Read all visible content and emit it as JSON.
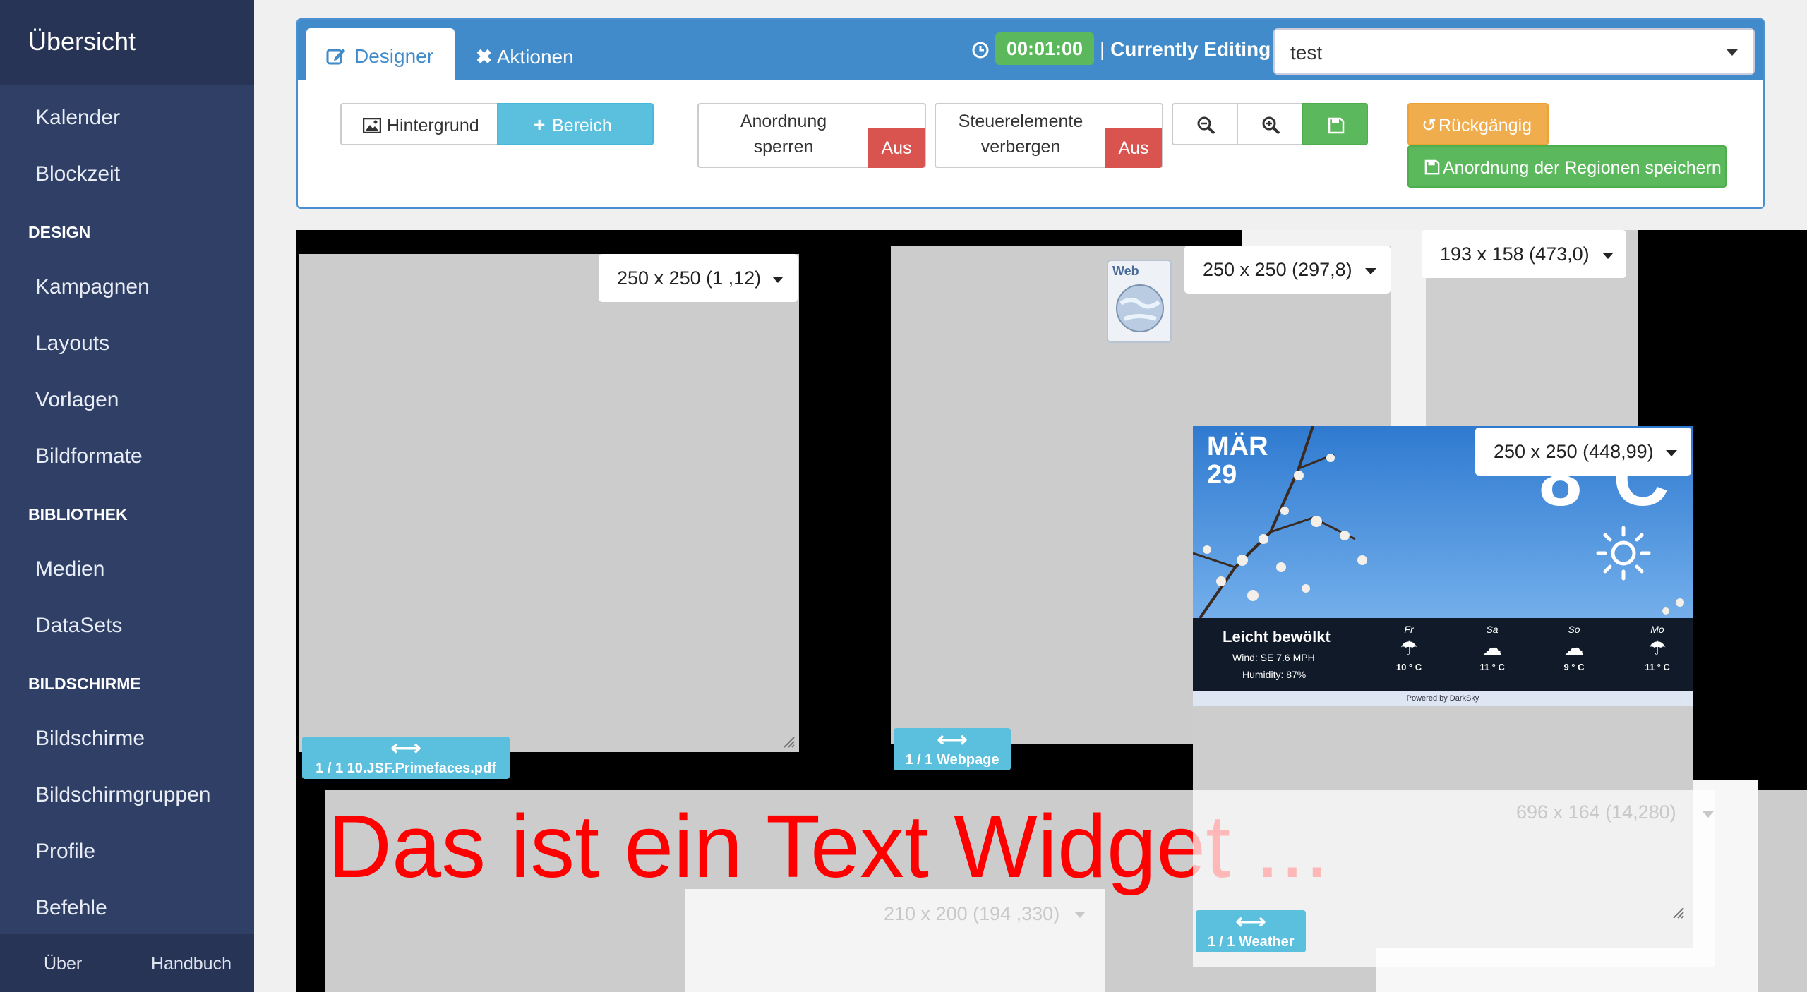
{
  "sidebar": {
    "title": "Übersicht",
    "items": [
      {
        "label": "Kalender"
      },
      {
        "label": "Blockzeit"
      },
      {
        "heading": "DESIGN"
      },
      {
        "label": "Kampagnen"
      },
      {
        "label": "Layouts"
      },
      {
        "label": "Vorlagen"
      },
      {
        "label": "Bildformate"
      },
      {
        "heading": "BIBLIOTHEK"
      },
      {
        "label": "Medien"
      },
      {
        "label": "DataSets"
      },
      {
        "heading": "BILDSCHIRME"
      },
      {
        "label": "Bildschirme"
      },
      {
        "label": "Bildschirmgruppen"
      },
      {
        "label": "Profile"
      },
      {
        "label": "Befehle"
      }
    ],
    "footer": {
      "about": "Über",
      "manual": "Handbuch"
    }
  },
  "header": {
    "tabs": [
      {
        "label": "Designer"
      },
      {
        "label": "Aktionen"
      }
    ],
    "timer": "00:01:00",
    "separator": "|",
    "editing_label": "Currently Editing",
    "layout_select": "test"
  },
  "toolbar": {
    "background": "Hintergrund",
    "add_region": "Bereich",
    "lock_layout": {
      "line1": "Anordnung",
      "line2": "sperren",
      "state": "Aus"
    },
    "hide_controls": {
      "line1": "Steuerelemente",
      "line2": "verbergen",
      "state": "Aus"
    },
    "undo": "Rückgängig",
    "save_regions": "Anordnung der Regionen speichern"
  },
  "regions": {
    "r1": {
      "dims": "250 x 250 (1 ,12)",
      "badge": "1 / 1 10.JSF.Primefaces.pdf"
    },
    "r2": {
      "dims": "250 x 250 (297,8)",
      "badge": "1 / 1 Webpage",
      "web_icon_label": "Web"
    },
    "r3": {
      "dims": "193 x 158 (473,0)"
    },
    "r4": {
      "dims": "250 x 250 (448,99)",
      "badge": "1 / 1 Weather"
    },
    "r5": {
      "dims": "696 x 164 (14,280)",
      "dims_partial": "4)",
      "text": "Das ist ein Text Widget ..."
    },
    "r6": {
      "dims": "210 x 200 (194 ,330)"
    }
  },
  "weather": {
    "month": "MÄR",
    "day": "29",
    "temp": "8°C",
    "condition": "Leicht bewölkt",
    "wind": "Wind: SE 7.6 MPH",
    "humidity": "Humidity: 87%",
    "forecast": [
      {
        "day": "Fr",
        "temp": "10 ° C"
      },
      {
        "day": "Sa",
        "temp": "11 ° C"
      },
      {
        "day": "So",
        "temp": "9 ° C"
      },
      {
        "day": "Mo",
        "temp": "11 ° C"
      }
    ],
    "powered": "Powered by DarkSky"
  },
  "colors": {
    "accent": "#428bca",
    "sidebar": "#2f3f66",
    "info": "#5bc0de",
    "success": "#5cb85c",
    "danger": "#d9534f",
    "warning": "#f0ad4e",
    "text_widget": "#ff0000"
  }
}
